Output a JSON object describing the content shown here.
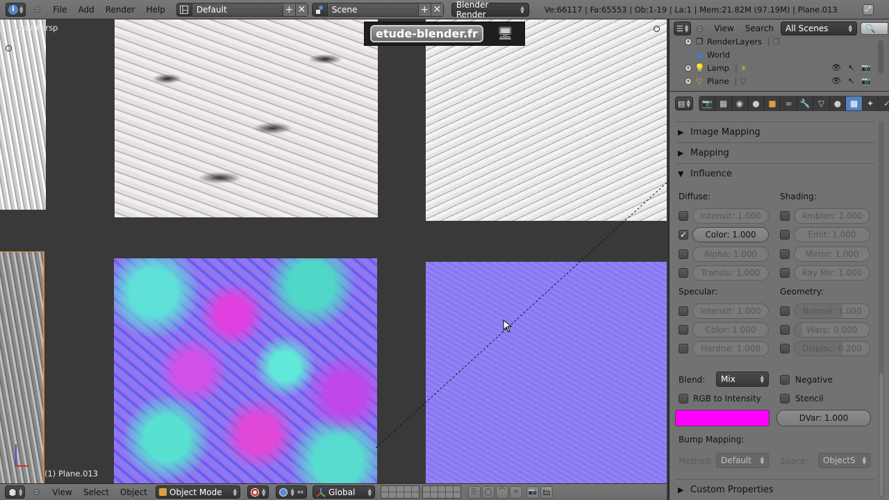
{
  "top_header": {
    "editor_type_icon": "info-icon",
    "menus": [
      "File",
      "Add",
      "Render",
      "Help"
    ],
    "screen_layout": {
      "value": "Default",
      "icon": "screen-layout-icon"
    },
    "scene": {
      "value": "Scene",
      "icon": "scene-icon"
    },
    "render_engine": "Blender Render",
    "stats": "Ve:66117 | Fa:65553 | Ob:1-19 | La:1 | Mem:21.82M (97.19M) | Plane.013",
    "fullscreen_icon": "fullscreen-icon"
  },
  "viewport": {
    "view_label": "User Persp",
    "object_label": "(1) Plane.013",
    "watermark": "etude-blender.fr"
  },
  "viewport_header": {
    "menus": [
      "View",
      "Select",
      "Object"
    ],
    "mode": "Object Mode",
    "pivot_icon": "pivot-point-icon",
    "transform_orientation": "Global"
  },
  "outliner": {
    "menus": [
      "View",
      "Search"
    ],
    "display_mode": "All Scenes",
    "items": [
      {
        "label": "RenderLayers",
        "icon": "render-layers-icon",
        "expandable": true
      },
      {
        "label": "World",
        "icon": "world-icon",
        "expandable": false
      },
      {
        "label": "Lamp",
        "icon": "lamp-icon",
        "expandable": true
      },
      {
        "label": "Plane",
        "icon": "mesh-icon",
        "expandable": true
      }
    ]
  },
  "properties": {
    "context_tabs": [
      "render",
      "render-layers",
      "scene",
      "world",
      "object",
      "constraints",
      "modifiers",
      "data",
      "material",
      "texture",
      "particles",
      "physics"
    ],
    "active_tab": "texture",
    "panels": {
      "image_mapping": "Image Mapping",
      "mapping": "Mapping",
      "influence": "Influence",
      "custom_properties": "Custom Properties"
    },
    "influence": {
      "diffuse_label": "Diffuse:",
      "shading_label": "Shading:",
      "specular_label": "Specular:",
      "geometry_label": "Geometry:",
      "diffuse": [
        {
          "label": "Intensit: 1.000",
          "checked": false,
          "value": 1.0
        },
        {
          "label": "Color: 1.000",
          "checked": true,
          "value": 1.0
        },
        {
          "label": "Alpha: 1.000",
          "checked": false,
          "value": 1.0
        },
        {
          "label": "Translu: 1.000",
          "checked": false,
          "value": 1.0
        }
      ],
      "shading": [
        {
          "label": "Ambien: 1.000",
          "checked": false,
          "value": 1.0
        },
        {
          "label": "Emit: 1.000",
          "checked": false,
          "value": 1.0
        },
        {
          "label": "Mirror: 1.000",
          "checked": false,
          "value": 1.0
        },
        {
          "label": "Ray Mir: 1.000",
          "checked": false,
          "value": 1.0
        }
      ],
      "specular": [
        {
          "label": "Intensit: 1.000",
          "checked": false,
          "value": 1.0
        },
        {
          "label": "Color: 1.000",
          "checked": false,
          "value": 1.0
        },
        {
          "label": "Hardne: 1.000",
          "checked": false,
          "value": 1.0
        }
      ],
      "geometry": [
        {
          "label": "Normal: 1.000",
          "checked": false,
          "value": 1.0
        },
        {
          "label": "Warp: 0.000",
          "checked": false,
          "value": 0.0
        },
        {
          "label": "Displac: 0.200",
          "checked": false,
          "value": 0.2
        }
      ],
      "blend_label": "Blend:",
      "blend_value": "Mix",
      "negative_label": "Negative",
      "rgb_to_intensity_label": "RGB to Intensity",
      "stencil_label": "Stencil",
      "color_swatch": "#ff00ff",
      "dvar_label": "DVar: 1.000",
      "bump_mapping_label": "Bump Mapping:",
      "method_label": "Method:",
      "method_value": "Default",
      "space_label": "Space:",
      "space_value": "ObjectS"
    }
  }
}
